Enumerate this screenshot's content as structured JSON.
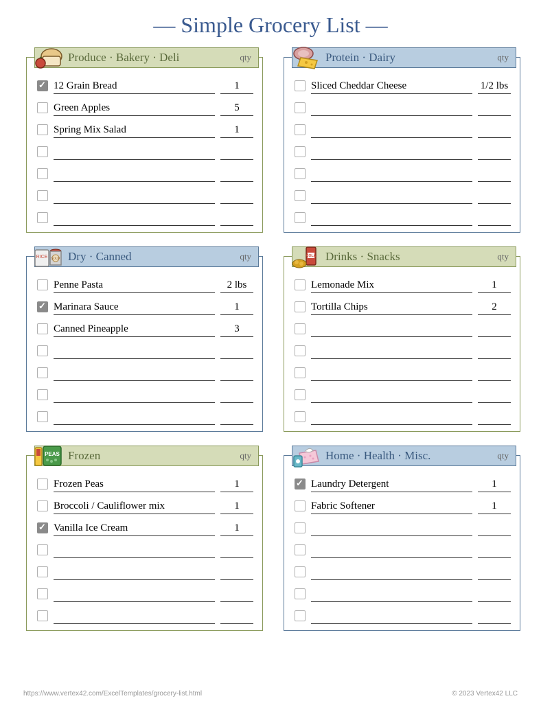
{
  "title": "— Simple Grocery List —",
  "qty_label": "qty",
  "footer": {
    "url": "https://www.vertex42.com/ExcelTemplates/grocery-list.html",
    "copyright": "© 2023 Vertex42 LLC"
  },
  "sections": [
    {
      "title": "Produce · Bakery · Deli",
      "color": "green",
      "icon": "bread",
      "rows": 7,
      "items": [
        {
          "checked": true,
          "name": "12 Grain Bread",
          "qty": "1"
        },
        {
          "checked": false,
          "name": "Green Apples",
          "qty": "5"
        },
        {
          "checked": false,
          "name": "Spring Mix Salad",
          "qty": "1"
        }
      ]
    },
    {
      "title": "Protein · Dairy",
      "color": "blue",
      "icon": "cheese",
      "rows": 7,
      "items": [
        {
          "checked": false,
          "name": "Sliced Cheddar Cheese",
          "qty": "1/2 lbs"
        }
      ]
    },
    {
      "title": "Dry · Canned",
      "color": "blue",
      "icon": "rice-can",
      "rows": 7,
      "items": [
        {
          "checked": false,
          "name": "Penne Pasta",
          "qty": "2 lbs"
        },
        {
          "checked": true,
          "name": "Marinara Sauce",
          "qty": "1"
        },
        {
          "checked": false,
          "name": "Canned Pineapple",
          "qty": "3"
        }
      ]
    },
    {
      "title": "Drinks · Snacks",
      "color": "green",
      "icon": "cola",
      "rows": 7,
      "items": [
        {
          "checked": false,
          "name": "Lemonade Mix",
          "qty": "1"
        },
        {
          "checked": false,
          "name": "Tortilla Chips",
          "qty": "2"
        }
      ]
    },
    {
      "title": "Frozen",
      "color": "green",
      "icon": "peas",
      "rows": 7,
      "items": [
        {
          "checked": false,
          "name": "Frozen Peas",
          "qty": "1"
        },
        {
          "checked": false,
          "name": "Broccoli / Cauliflower mix",
          "qty": "1"
        },
        {
          "checked": true,
          "name": "Vanilla Ice Cream",
          "qty": "1"
        }
      ]
    },
    {
      "title": "Home · Health · Misc.",
      "color": "blue",
      "icon": "tissue",
      "rows": 7,
      "items": [
        {
          "checked": true,
          "name": "Laundry Detergent",
          "qty": "1"
        },
        {
          "checked": false,
          "name": "Fabric Softener",
          "qty": "1"
        }
      ]
    }
  ]
}
